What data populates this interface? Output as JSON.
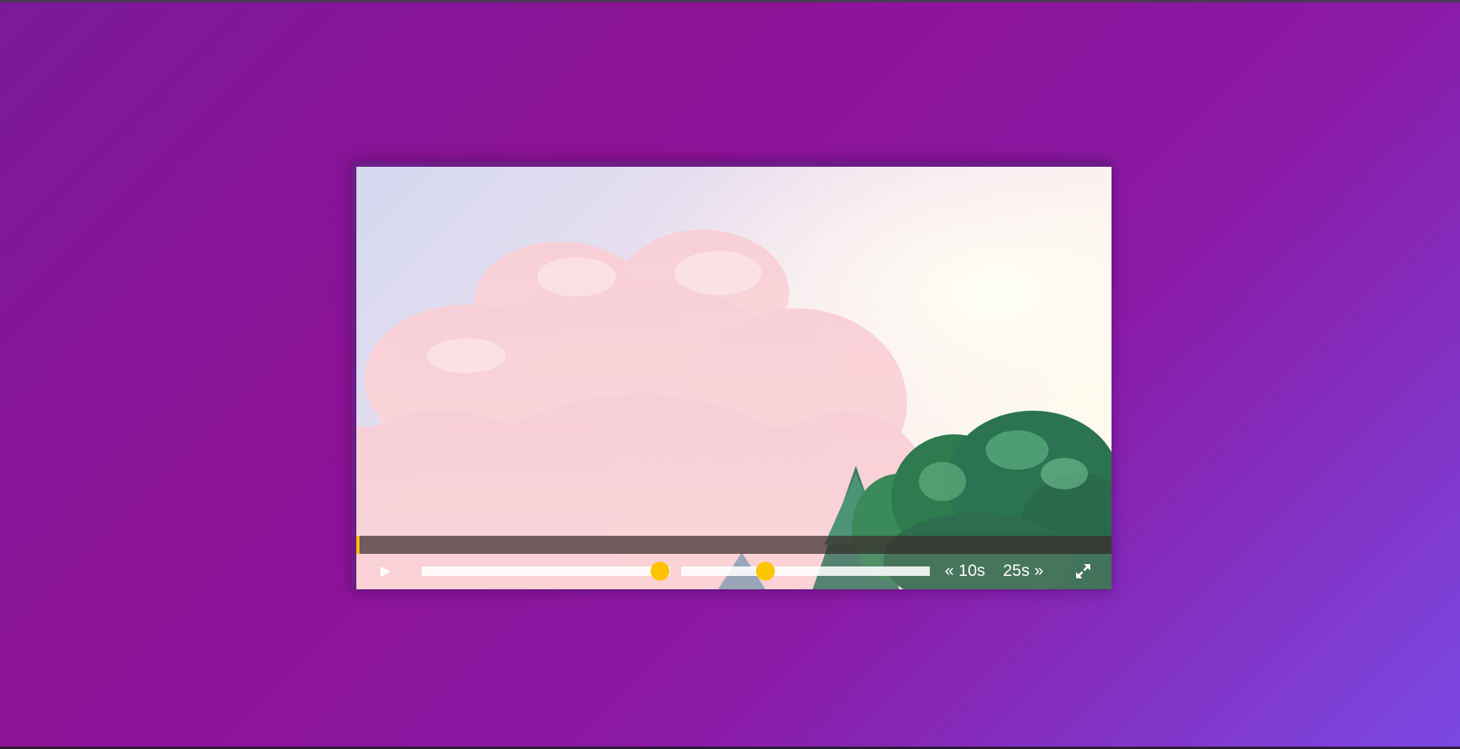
{
  "player": {
    "progress_fraction": 0.0,
    "play_icon": "play-icon",
    "play_glyph": "▶",
    "volume_fraction": 0.96,
    "playback_rate_fraction": 0.34,
    "skip_back_label": "« 10s",
    "skip_forward_label": "25s »",
    "fullscreen_icon": "fullscreen-icon"
  },
  "colors": {
    "accent": "#ffc400",
    "progress_track": "#5a4646"
  }
}
